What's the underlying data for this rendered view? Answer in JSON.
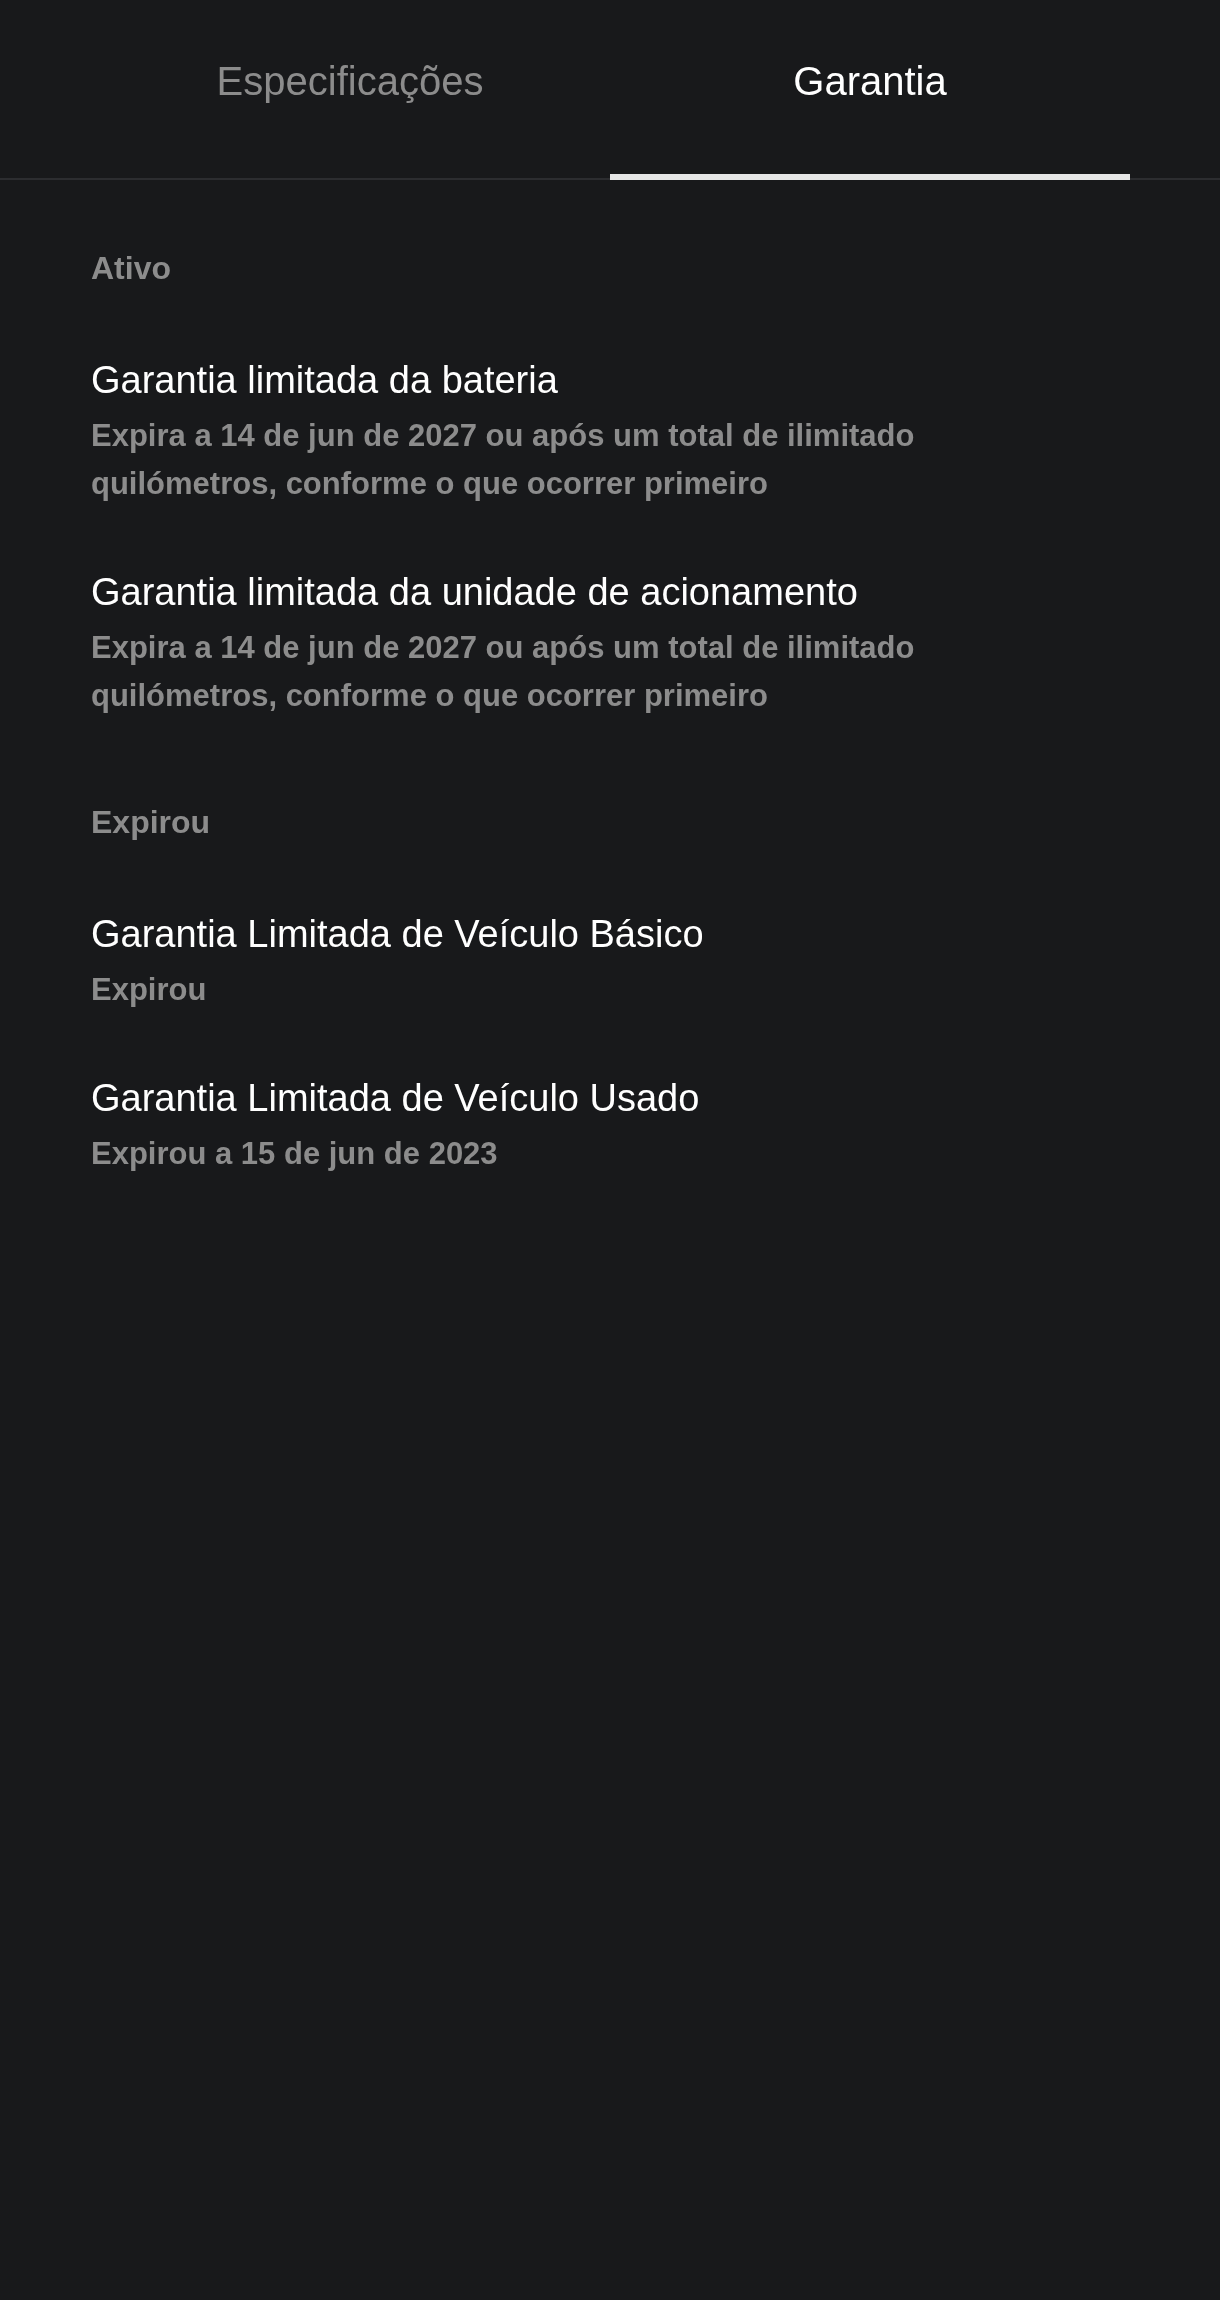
{
  "tabs": [
    {
      "label": "Especificações",
      "selected": false
    },
    {
      "label": "Garantia",
      "selected": true
    }
  ],
  "sections": [
    {
      "heading": "Ativo",
      "items": [
        {
          "title": "Garantia limitada da bateria",
          "detail": "Expira a 14 de jun de 2027 ou após um total de ilimitado quilómetros, conforme o que ocorrer primeiro"
        },
        {
          "title": "Garantia limitada da unidade de acionamento",
          "detail": "Expira a 14 de jun de 2027 ou após um total de ilimitado quilómetros, conforme o que ocorrer primeiro"
        }
      ]
    },
    {
      "heading": "Expirou",
      "items": [
        {
          "title": "Garantia Limitada de Veículo Básico",
          "detail": "Expirou"
        },
        {
          "title": "Garantia Limitada de Veículo Usado",
          "detail": "Expirou a 15 de jun de 2023"
        }
      ]
    }
  ]
}
